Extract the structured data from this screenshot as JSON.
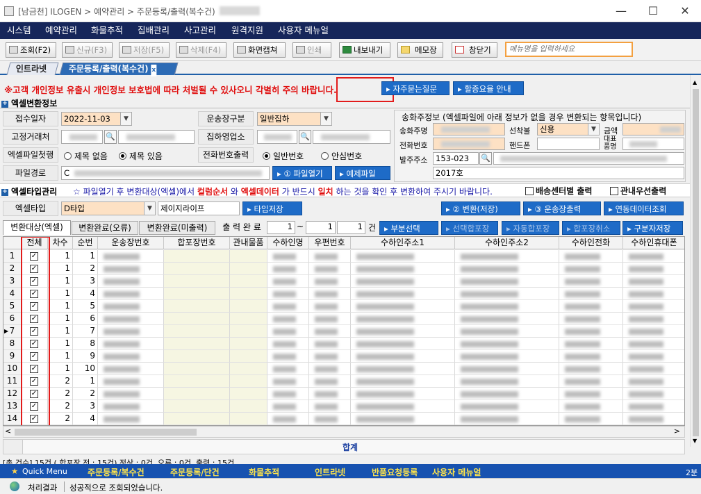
{
  "window": {
    "title": "[남금천] ILOGEN > 예약관리 > 주문등록/출력(복수건)"
  },
  "menu": [
    "시스템",
    "예약관리",
    "화물추적",
    "집배관리",
    "사고관리",
    "원격지원",
    "사용자 메뉴얼"
  ],
  "toolbar": {
    "buttons": [
      {
        "label": "조회(F2)",
        "enabled": true
      },
      {
        "label": "신규(F3)",
        "enabled": false
      },
      {
        "label": "저장(F5)",
        "enabled": false
      },
      {
        "label": "삭제(F4)",
        "enabled": false
      },
      {
        "label": "화면캡쳐",
        "enabled": true
      },
      {
        "label": "인쇄",
        "enabled": false
      },
      {
        "label": "내보내기",
        "enabled": true,
        "highlighted": true
      },
      {
        "label": "메모장",
        "enabled": true
      },
      {
        "label": "창닫기",
        "enabled": true
      }
    ],
    "search_placeholder": "메뉴명을 입력하세요"
  },
  "tabs": [
    {
      "label": "인트라넷",
      "active": false
    },
    {
      "label": "주문등록/출력(복수건)",
      "active": true
    }
  ],
  "warning": "※고객 개인정보 유출시 개인정보 보호법에 따라 처벌될 수 있사오니 각별히 주의 바랍니다.",
  "warning_buttons": [
    "자주묻는질문",
    "할증요율 안내"
  ],
  "excel_section": {
    "title": "엑셀변환정보",
    "receipt_date_label": "접수일자",
    "receipt_date": "2022-11-03",
    "waybill_type_label": "운송장구분",
    "waybill_type": "일반집하",
    "fixed_customer_label": "고정거래처",
    "pickup_office_label": "집하영업소",
    "first_row_label": "엑셀파일첫행",
    "first_row_options": [
      "제목 없음",
      "제목 있음"
    ],
    "first_row_selected": 1,
    "phone_output_label": "전화번호출력",
    "phone_output_options": [
      "일반번호",
      "안심번호"
    ],
    "phone_output_selected": 0,
    "file_path_label": "파일경로",
    "file_path_prefix": "C",
    "open_file_button": "① 파일열기",
    "example_file_button": "예제파일"
  },
  "sender": {
    "title": "송화주정보 (엑셀파일에 아래 정보가 없을 경우 변환되는 항목입니다)",
    "name_label": "송화주명",
    "pay_label": "선착불",
    "pay_value": "신용",
    "amount_label": "금액",
    "phone_label": "전화번호",
    "mobile_label": "핸드폰",
    "rep_item_label": "대표품명",
    "address_label": "발주주소",
    "zip": "153-023",
    "address_detail": "2017호"
  },
  "excel_type_section": {
    "title": "엑셀타입관리",
    "notice_parts": [
      {
        "text": "☆ 파일열기 후 변환대상(엑셀)에서 ",
        "color": "#1a1aa8"
      },
      {
        "text": "컬럼순서",
        "color": "#e01010"
      },
      {
        "text": " 와 ",
        "color": "#1a1aa8"
      },
      {
        "text": "엑셀데이터",
        "color": "#e01010"
      },
      {
        "text": " 가 반드시 ",
        "color": "#1a1aa8"
      },
      {
        "text": "일치",
        "color": "#e01010"
      },
      {
        "text": " 하는 것을 확인 후 변환하여 주시기 바랍니다.",
        "color": "#1a1aa8"
      }
    ],
    "checkbox1": "배송센터별 출력",
    "checkbox2": "관내우선출력",
    "type_label": "엑셀타입",
    "type_value": "D타입",
    "type_name": "제이지라이프",
    "type_save_button": "타입저장",
    "convert_button": "② 변환(저장)",
    "print_button": "③ 운송장출력",
    "link_button": "연동데이터조회"
  },
  "result_tabs": [
    "변환대상(엑셀)",
    "변환완료(오류)",
    "변환완료(미출력)"
  ],
  "print_complete": {
    "label": "출 력 완 료",
    "from": "1",
    "to": "1",
    "count": "1",
    "unit": "건"
  },
  "action_buttons": [
    "부분선택",
    "선택합포장",
    "자동합포장",
    "합포장취소",
    "구분자저장"
  ],
  "grid": {
    "columns": [
      "전체",
      "차수",
      "순번",
      "운송장번호",
      "합포장번호",
      "관내물품",
      "수하인명",
      "우편번호",
      "수하인주소1",
      "수하인주소2",
      "수하인전화",
      "수하인휴대폰"
    ],
    "rows": [
      {
        "n": "1",
        "cha": "1",
        "seq": "1"
      },
      {
        "n": "2",
        "cha": "1",
        "seq": "2"
      },
      {
        "n": "3",
        "cha": "1",
        "seq": "3"
      },
      {
        "n": "4",
        "cha": "1",
        "seq": "4"
      },
      {
        "n": "5",
        "cha": "1",
        "seq": "5"
      },
      {
        "n": "6",
        "cha": "1",
        "seq": "6"
      },
      {
        "n": "7",
        "cha": "1",
        "seq": "7",
        "current": true
      },
      {
        "n": "8",
        "cha": "1",
        "seq": "8"
      },
      {
        "n": "9",
        "cha": "1",
        "seq": "9"
      },
      {
        "n": "10",
        "cha": "1",
        "seq": "10"
      },
      {
        "n": "11",
        "cha": "2",
        "seq": "1"
      },
      {
        "n": "12",
        "cha": "2",
        "seq": "2"
      },
      {
        "n": "13",
        "cha": "2",
        "seq": "3"
      },
      {
        "n": "14",
        "cha": "2",
        "seq": "4"
      }
    ]
  },
  "total_label": "합계",
  "summary": "[총 건수] 15건 ( 합포장 전 : 15건) 정상 : 0건, 오류 : 0건, 출력 : 15건",
  "quickbar": {
    "label": "Quick Menu",
    "items": [
      "주문등록/복수건",
      "주문등록/단건",
      "화물추적",
      "인트라넷",
      "반품요청등록",
      "사용자 메뉴얼"
    ],
    "time": "2분"
  },
  "status": {
    "label": "처리결과",
    "message": "성공적으로 조회되었습니다."
  }
}
